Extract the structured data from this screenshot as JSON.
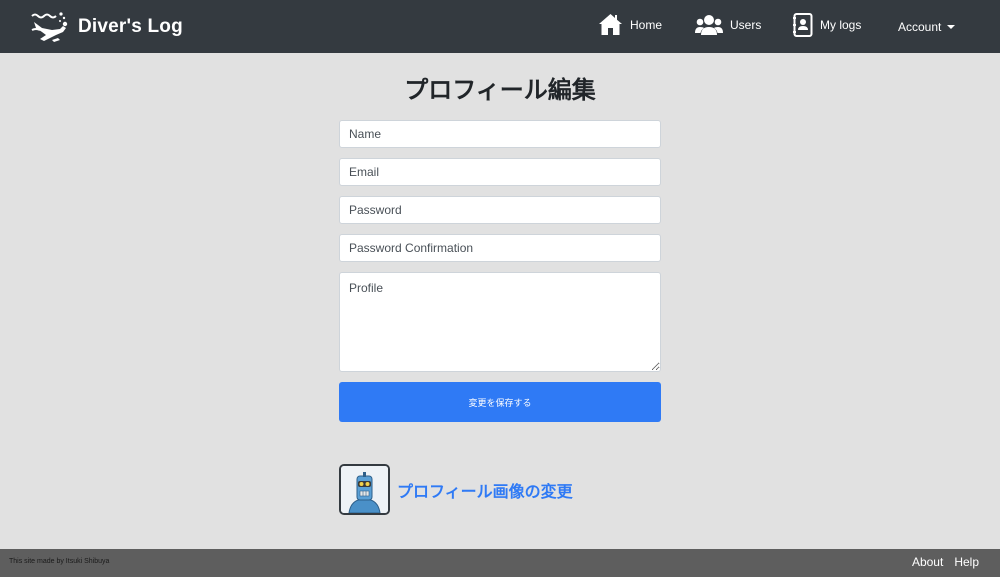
{
  "brand": {
    "name": "Diver's Log",
    "logo_icon": "scuba-diver-icon"
  },
  "nav": {
    "home": {
      "label": "Home",
      "icon": "home-icon"
    },
    "users": {
      "label": "Users",
      "icon": "users-icon"
    },
    "mylogs": {
      "label": "My logs",
      "icon": "contact-book-icon"
    },
    "account": {
      "label": "Account",
      "icon": "caret-down-icon"
    }
  },
  "page": {
    "title": "プロフィール編集"
  },
  "form": {
    "name_placeholder": "Name",
    "email_placeholder": "Email",
    "password_placeholder": "Password",
    "password_confirmation_placeholder": "Password Confirmation",
    "profile_placeholder": "Profile",
    "submit_label": "変更を保存する"
  },
  "profile_image": {
    "link_label": "プロフィール画像の変更",
    "avatar_icon": "robot-avatar"
  },
  "footer": {
    "credit": "This site made by Itsuki Shibuya",
    "links": [
      "About",
      "Help"
    ]
  },
  "colors": {
    "navbar": "#343a40",
    "accent": "#2f7af5",
    "background": "#e1e1e1",
    "footer": "#5e5e5e"
  }
}
